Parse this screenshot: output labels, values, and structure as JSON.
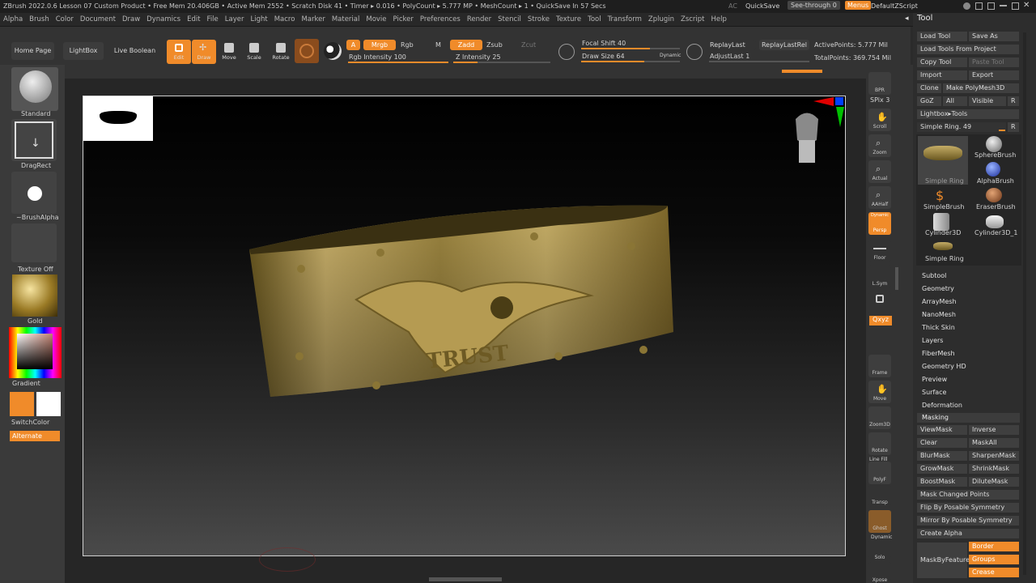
{
  "titlebar": {
    "text": "ZBrush 2022.0.6   Lesson 07 Custom Product   • Free Mem 20.406GB • Active Mem 2552 • Scratch Disk 41 • Timer ▸ 0.016 • PolyCount ▸ 5.777 MP • MeshCount ▸ 1 • QuickSave In 57 Secs",
    "ac": "AC",
    "quicksave": "QuickSave",
    "see_through": "See-through  0",
    "menus": "Menus",
    "script": "DefaultZScript"
  },
  "menu": [
    "Alpha",
    "Brush",
    "Color",
    "Document",
    "Draw",
    "Dynamics",
    "Edit",
    "File",
    "Layer",
    "Light",
    "Macro",
    "Marker",
    "Material",
    "Movie",
    "Picker",
    "Preferences",
    "Render",
    "Stencil",
    "Stroke",
    "Texture",
    "Tool",
    "Transform",
    "Zplugin",
    "Zscript",
    "Help"
  ],
  "toolbar": {
    "home": "Home Page",
    "lightbox": "LightBox",
    "live_boolean": "Live Boolean",
    "edit": "Edit",
    "draw": "Draw",
    "move": "Move",
    "scale": "Scale",
    "rotate": "Rotate",
    "a": "A",
    "mrgb": "Mrgb",
    "rgb": "Rgb",
    "m": "M",
    "rgb_intensity": "Rgb Intensity 100",
    "rgb_intensity_value": 100,
    "zadd": "Zadd",
    "zsub": "Zsub",
    "zcut": "Zcut",
    "z_intensity": "Z Intensity 25",
    "z_intensity_value": 25,
    "focal_shift": "Focal Shift 40",
    "focal_value": 40,
    "draw_size": "Draw Size 64",
    "draw_size_value": 64,
    "dynamic": "Dynamic",
    "replay_last": "ReplayLast",
    "replay_last_rel": "ReplayLastRel",
    "adjust_last": "AdjustLast 1",
    "active_points": "ActivePoints: 5.777 Mil",
    "total_points": "TotalPoints: 369.754 Mil"
  },
  "left": {
    "brush": "Standard",
    "stroke": "DragRect",
    "alpha": "~BrushAlpha",
    "texture": "Texture Off",
    "material": "Gold",
    "gradient": "Gradient",
    "switch": "SwitchColor",
    "alternate": "Alternate"
  },
  "right": {
    "bpr": "BPR",
    "spix": "SPix 3",
    "scroll": "Scroll",
    "zoom": "Zoom",
    "actual": "Actual",
    "aahalf": "AAHalf",
    "dynamic": "Dynamic",
    "persp": "Persp",
    "floor": "Floor",
    "lsym": "L.Sym",
    "xyz": "Qxyz",
    "frame": "Frame",
    "move": "Move",
    "zoom3d": "Zoom3D",
    "rotate": "Rotate",
    "linefill": "Line Fill",
    "polyf": "PolyF",
    "transp": "Transp",
    "ghost": "Ghost",
    "dynamic2": "Dynamic",
    "solo": "Solo",
    "xpose": "Xpose"
  },
  "tool": {
    "title": "Tool",
    "load": "Load Tool",
    "saveas": "Save As",
    "load_project": "Load Tools From Project",
    "copy": "Copy Tool",
    "paste": "Paste Tool",
    "import": "Import",
    "export": "Export",
    "clone": "Clone",
    "make_poly": "Make PolyMesh3D",
    "goz": "GoZ",
    "all": "All",
    "visible": "Visible",
    "r": "R",
    "lightbox_tools": "Lightbox▸Tools",
    "current": "Simple Ring. 49",
    "thumbs": [
      "Simple Ring",
      "SphereBrush",
      "SimpleBrush",
      "AlphaBrush",
      "EraserBrush",
      "Cylinder3D",
      "Cylinder3D_1",
      "Simple Ring"
    ],
    "panels": [
      "Subtool",
      "Geometry",
      "ArrayMesh",
      "NanoMesh",
      "Thick Skin",
      "Layers",
      "FiberMesh",
      "Geometry HD",
      "Preview",
      "Surface",
      "Deformation"
    ],
    "masking": {
      "title": "Masking",
      "viewmask": "ViewMask",
      "inverse": "Inverse",
      "clear": "Clear",
      "maskall": "MaskAll",
      "blurmask": "BlurMask",
      "sharpenmask": "SharpenMask",
      "growmask": "GrowMask",
      "shrinkmask": "ShrinkMask",
      "boostmask": "BoostMask",
      "dilutemask": "DiluteMask",
      "changed": "Mask Changed Points",
      "flip": "Flip By Posable Symmetry",
      "mirror": "Mirror By Posable Symmetry",
      "create_alpha": "Create Alpha",
      "bynfeature": "MaskByFeature",
      "border": "Border",
      "groups": "Groups",
      "crease": "Crease"
    }
  },
  "colors": {
    "accent": "#f08b2a",
    "gold": "#b8a060"
  },
  "ring": {
    "engraving": "TRUST"
  }
}
